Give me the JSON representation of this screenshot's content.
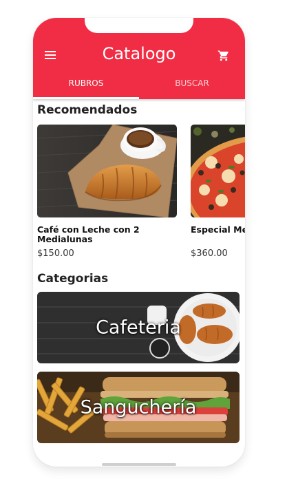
{
  "appbar": {
    "title": "Catalogo"
  },
  "tabs": [
    {
      "label": "RUBROS",
      "active": true
    },
    {
      "label": "BUSCAR",
      "active": false
    }
  ],
  "recommended": {
    "heading": "Recomendados",
    "items": [
      {
        "name": "Café con Leche con 2 Medialunas",
        "price": "$150.00"
      },
      {
        "name": "Especial Mediana",
        "price": "$360.00"
      }
    ]
  },
  "categories": {
    "heading": "Categorias",
    "items": [
      {
        "label": "Cafeteria"
      },
      {
        "label": "Sanguchería"
      }
    ]
  },
  "icons": {
    "menu": "menu-icon",
    "cart": "cart-icon"
  },
  "colors": {
    "primary": "#f02d44",
    "tab_indicator": "#ffffff"
  }
}
